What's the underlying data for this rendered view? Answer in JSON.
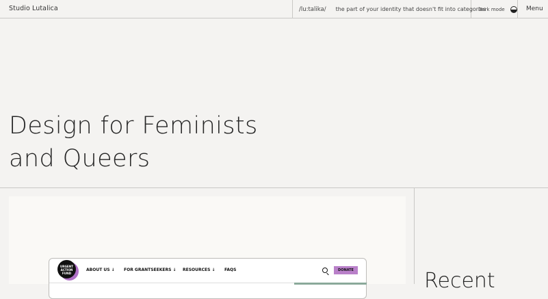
{
  "header": {
    "brand": "Studio Lutalica",
    "pronunciation": "/lu:talika/",
    "definition": "the part of your identity that doesn't fit into categories",
    "dark_mode_label": "Dark mode",
    "menu_label": "Menu"
  },
  "hero": {
    "line1": "Design for Feminists",
    "line2": "and Queers"
  },
  "mockup": {
    "logo_text": "URGENT ACTION FUND",
    "nav": [
      "ABOUT US ↓",
      "FOR GRANTSEEKERS ↓",
      "RESOURCES ↓",
      "FAQS"
    ],
    "donate": "DONATE"
  },
  "sidebar": {
    "heading": "Recent"
  },
  "colors": {
    "background": "#f4f3f1",
    "card": "#faf9f6",
    "donate": "#b980c9",
    "accent_bar": "#8aa99a"
  }
}
